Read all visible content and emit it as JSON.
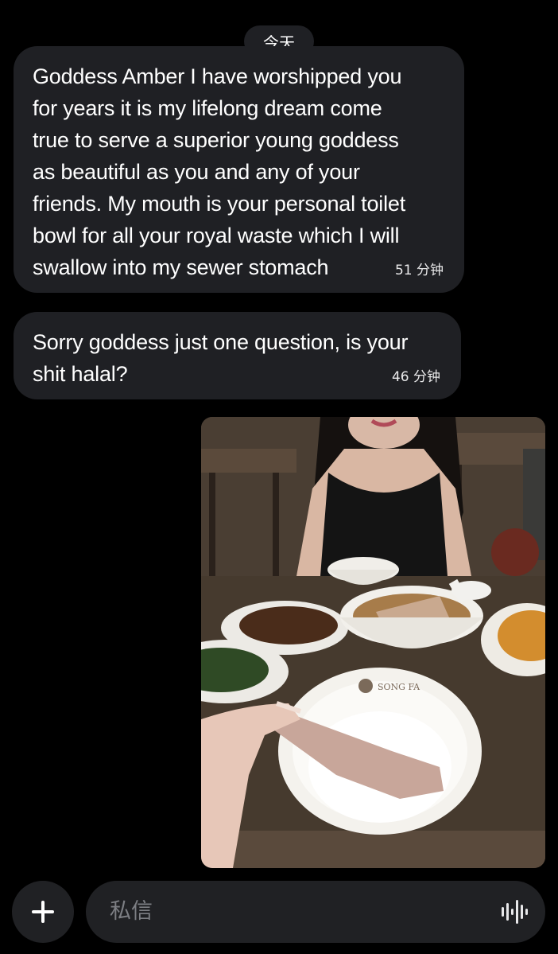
{
  "conversation": {
    "date_label": "今天",
    "messages": [
      {
        "text": "Goddess Amber I have worshipped you\nfor years it is my lifelong dream come\ntrue to serve a superior young goddess\nas beautiful as you and any of your\nfriends. My mouth is your personal toilet\nbowl for all your royal waste which I will\nswallow into my sewer stomach",
        "time": "51 分钟"
      },
      {
        "text": "Sorry goddess just one question, is your\nshit halal?",
        "time": "46 分钟"
      }
    ],
    "photo": {
      "bowl_brand": "SONG FA"
    }
  },
  "composer": {
    "placeholder": "私信",
    "add_icon": "plus-icon",
    "voice_icon": "voice-waveform-icon"
  },
  "colors": {
    "background": "#000000",
    "bubble": "#1f2024",
    "composer": "#202124",
    "placeholder": "#7d7f84"
  }
}
